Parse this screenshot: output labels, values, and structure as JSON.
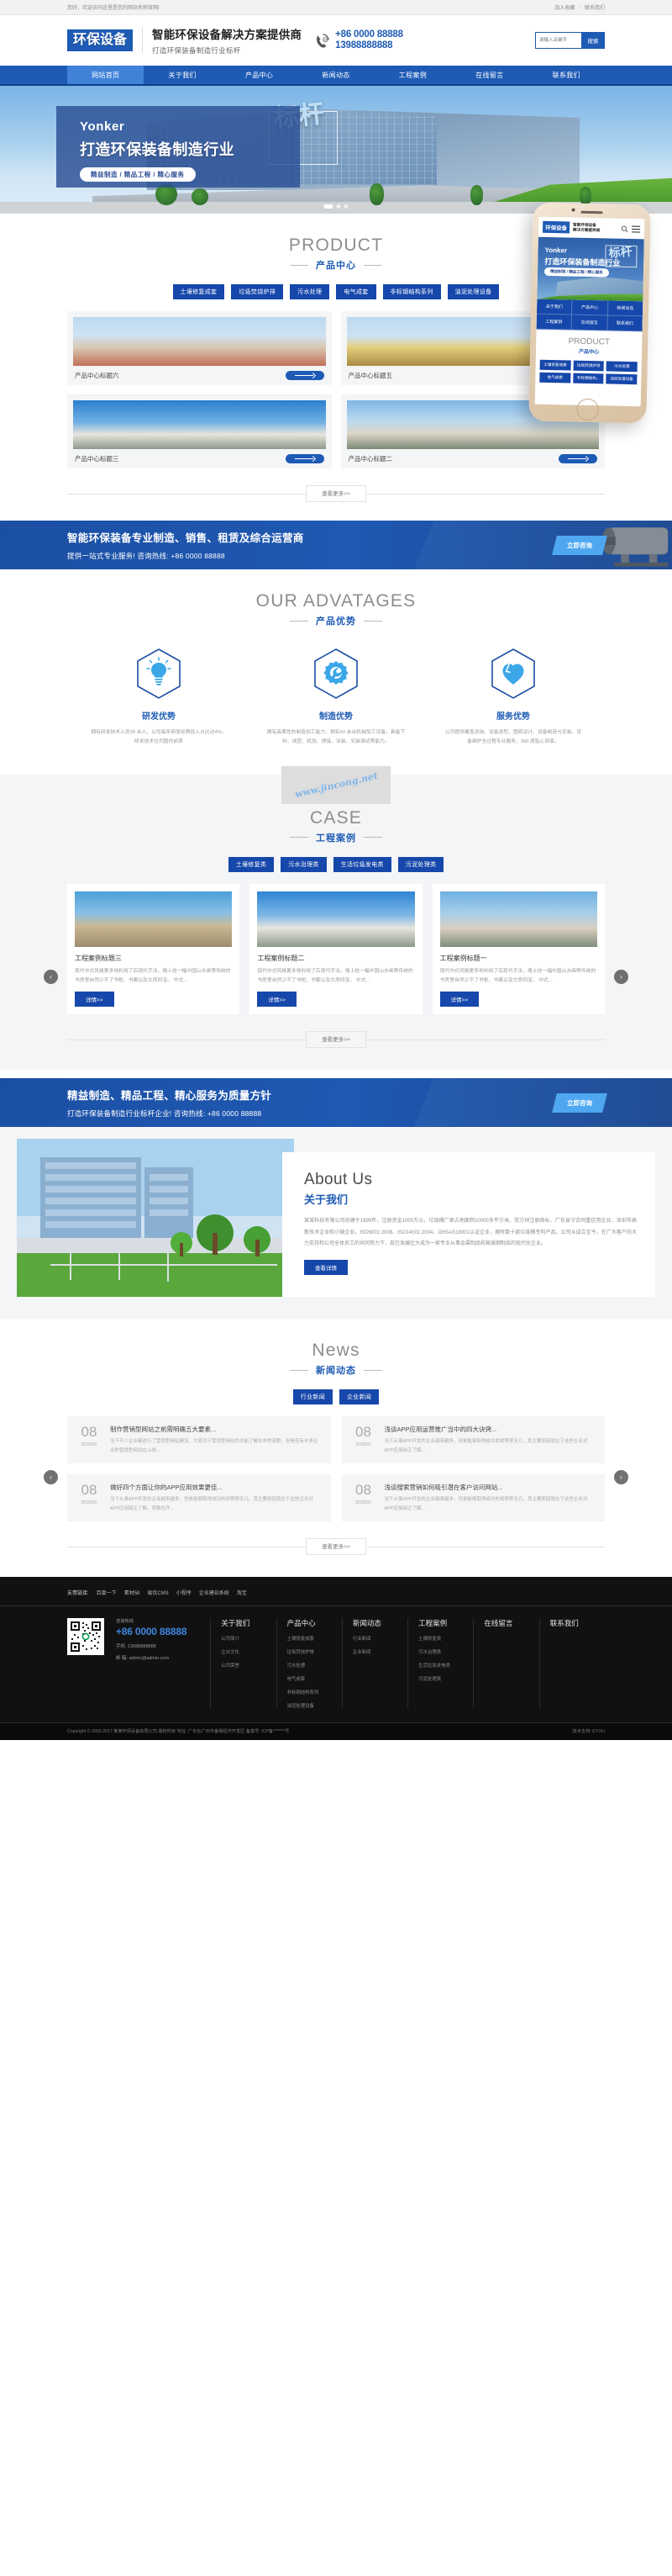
{
  "topbar": {
    "welcome": "您好，欢迎访问这里是您的网站名称官网!",
    "fav": "加入收藏",
    "sep": "|",
    "contact": "联系我们"
  },
  "header": {
    "logo": "环保设备",
    "slogan_main": "智能环保设备解决方案提供商",
    "slogan_sub": "打造环保装备制造行业标杆",
    "phone_icon": "phone-24h-icon",
    "phone1": "+86 0000 88888",
    "phone2": "13988888888",
    "search_placeholder": "请输入关键字",
    "search_button": "搜索"
  },
  "nav": [
    {
      "label": "网站首页",
      "active": true
    },
    {
      "label": "关于我们",
      "active": false
    },
    {
      "label": "产品中心",
      "active": false
    },
    {
      "label": "新闻动态",
      "active": false
    },
    {
      "label": "工程案例",
      "active": false
    },
    {
      "label": "在线留言",
      "active": false
    },
    {
      "label": "联系我们",
      "active": false
    }
  ],
  "hero": {
    "en": "Yonker",
    "cn": "打造环保装备制造行业",
    "accent": "标杆",
    "pill": "精益制造  /  精品工程  /  精心服务",
    "dots": 3,
    "active_dot": 0
  },
  "product": {
    "title_en": "PRODUCT",
    "title_cn": "产品中心",
    "categories": [
      "土壤修复成套",
      "垃圾焚烧炉排",
      "污水处理",
      "电气成套",
      "非标钢结构系列",
      "油泥处理设备"
    ],
    "items": [
      {
        "name": "产品中心标题六",
        "img": "silo-red-blue"
      },
      {
        "name": "产品中心标题五",
        "img": "silo-yellow"
      },
      {
        "name": "产品中心标题三",
        "img": "silo-rainbow"
      },
      {
        "name": "产品中心标题二",
        "img": "silo-plant"
      }
    ],
    "more": "查看更多>>"
  },
  "phone_mockup": {
    "logo": "环保设备",
    "slogan_l1": "智能环保设备",
    "slogan_l2": "解决方案提供商",
    "search_icon": "search-icon",
    "menu_icon": "hamburger-menu-icon",
    "hero_en": "Yonker",
    "hero_cn": "打造环保装备制造行业",
    "hero_accent": "标杆",
    "hero_pill": "精益制造 / 精品工程 / 精心服务",
    "nav": [
      "关于我们",
      "产品中心",
      "新闻动态",
      "工程案例",
      "在线留言",
      "联系我们"
    ],
    "sec_en": "PRODUCT",
    "sec_cn": "产品中心",
    "cats": [
      "土壤修复成套",
      "垃圾焚烧炉排",
      "污水处理",
      "电气成套",
      "非标钢结构...",
      "油泥处理设备"
    ]
  },
  "cta1": {
    "headline": "智能环保装备专业制造、销售、租赁及综合运营商",
    "sub": "提供一站式专业服务!    咨询热线: +86 0000 88888",
    "button": "立即咨询"
  },
  "advantages": {
    "title_en": "OUR ADVATAGES",
    "title_cn": "产品优势",
    "items": [
      {
        "icon": "lightbulb-icon",
        "title": "研发优势",
        "desc": "拥有研发技术人员30 余人，公司每年研发经费投入占比达4%，研发技术位列国内前茅"
      },
      {
        "icon": "gear-wrench-icon",
        "title": "制造优势",
        "desc": "拥有高柔性的制造加工能力，拥有50 余台机械加工设备，具备下料、成型、机加、焊接、涂装、安装调试等能力。"
      },
      {
        "icon": "heart-icon",
        "title": "服务优势",
        "desc": "公司提供覆盖咨询、设备选型、图纸设计、设备制造与安装、设备维护全过程专业服务，360 度贴心到家。"
      }
    ]
  },
  "watermark": "www.jincong.net",
  "case": {
    "title_en": "CASE",
    "title_cn": "工程案例",
    "categories": [
      "土壤修复类",
      "污水治理类",
      "生活垃圾发电类",
      "污泥处理类"
    ],
    "items": [
      {
        "title": "工程案例标题三",
        "desc": "现代中式风格更多地利用了后现代手法，墙上挂一幅中国山水画等传统的书房里自然少不了书柜、书案以及文房四宝。 中式...",
        "btn": "详情>>",
        "img": "plant-silo-tan"
      },
      {
        "title": "工程案例标题二",
        "desc": "现代中式风格更多地利用了后现代手法，墙上挂一幅中国山水画等传统的书房里自然少不了书柜、书案以及文房四宝。 中式...",
        "btn": "详情>>",
        "img": "plant-rainbow"
      },
      {
        "title": "工程案例标题一",
        "desc": "现代中式风格更多地利用了后现代手法，墙上挂一幅中国山水画等传统的书房里自然少不了书柜、书案以及文房四宝。 中式...",
        "btn": "详情>>",
        "img": "plant-tower"
      }
    ],
    "more": "查看更多>>",
    "prev_icon": "chevron-left-icon",
    "next_icon": "chevron-right-icon"
  },
  "cta2": {
    "headline": "精益制造、精品工程、精心服务为质量方针",
    "sub": "打造环保装备制造行业标杆企业!    咨询热线: +86 0000 88888",
    "button": "立即咨询"
  },
  "about": {
    "title_en": "About Us",
    "title_cn": "关于我们",
    "paragraph": "某某科技有限公司创建于1999年，注册资金1000万元，垃圾桶厂家占地面积10000多平方米、欣方圳注册商标、广东省守合同重信用企业、深圳市高新技术企业和小微企业，ISO9001:2008、ISO14001:2004、OHSAS18001认证企业，拥有数十款垃圾桶专利产品。公司从成立至今，在广大客户的大力支持和公司全体员工的共同努力下，现已发展壮大成为一家专业从事金属制品和玻璃钢制品的现代化企业。",
    "button": "查看详情",
    "img": "office-building"
  },
  "news": {
    "title_en": "News",
    "title_cn": "新闻动态",
    "tabs": [
      "行业新闻",
      "企业新闻"
    ],
    "items": [
      {
        "day": "08",
        "ym": "2019/01",
        "title": "制作营销型网站之前需明确五大要素...",
        "desc": "当下不少企业都进行了营销型网站建设，大家对于营销型网站的功能了解也非常清楚。但是任有许多企业的营销型网站在上线..."
      },
      {
        "day": "08",
        "ym": "2019/01",
        "title": "浅谈APP应用运营推广当中的四大诀窍...",
        "desc": "当下从事APP开发的企业越来越多，但是能够取得成功的却寥寥无几。其主要原因就在于这些企业对APP应用缺乏了解..."
      },
      {
        "day": "08",
        "ym": "2019/01",
        "title": "做好四个方面让你的APP应用效果更佳...",
        "desc": "当下从事APP开发的企业越来越多，但是能够取得成功的却寥寥无几。其主要原因就在于这些企业对APP应用缺乏了解，导致在开..."
      },
      {
        "day": "08",
        "ym": "2019/01",
        "title": "浅谈搜索营销如何吸引潜在客户访问网站...",
        "desc": "当下从事APP开发的企业越来越多，但是能够取得成功的却寥寥无几。其主要原因就在于这些企业对APP应用缺乏了解..."
      }
    ],
    "more": "查看更多>>"
  },
  "footer": {
    "friend_label": "友情链接:",
    "friend_links": [
      "百度一下",
      "素材58",
      "易优CMS",
      "小程序",
      "企业建站系统",
      "淘宝"
    ],
    "qr_alt": "qr-code",
    "hotline_label": "咨询热线",
    "hotline": "+86 0000 88888",
    "mobile": "手机: 13988888888",
    "email": "邮  箱: admin@admin.com",
    "columns": [
      {
        "head": "关于我们",
        "links": [
          "公司简介",
          "企业文化",
          "公司荣誉"
        ]
      },
      {
        "head": "产品中心",
        "links": [
          "土壤修复成套",
          "垃圾焚烧炉排",
          "污水处理",
          "电气成套",
          "非标钢结构系列",
          "油泥处理设备"
        ]
      },
      {
        "head": "新闻动态",
        "links": [
          "行业新闻",
          "企业新闻"
        ]
      },
      {
        "head": "工程案例",
        "links": [
          "土壤修复类",
          "污水治理类",
          "生活垃圾发电类",
          "污泥处理类"
        ]
      },
      {
        "head": "在线留言",
        "links": []
      },
      {
        "head": "联系我们",
        "links": []
      }
    ],
    "copyright": "Copyright © 2002-2017 某某环保设备有限公司 版权所有    地址: 广东省广州市番禺经济开发区    备案号: ICP备*******号",
    "tech": "技术支持: EYOU"
  }
}
